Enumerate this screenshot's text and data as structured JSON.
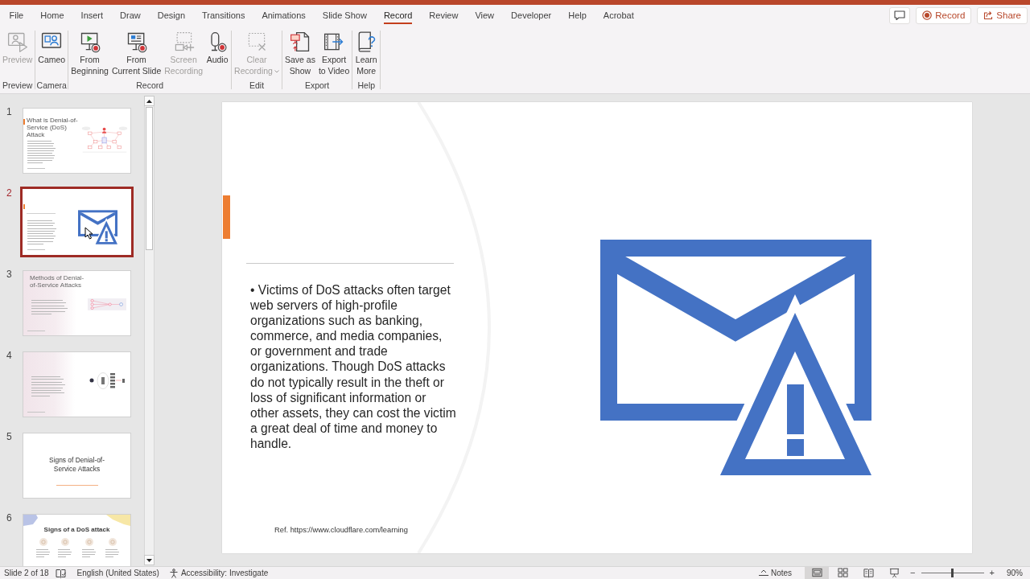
{
  "menu_tabs": [
    {
      "label": "File",
      "selected": false
    },
    {
      "label": "Home",
      "selected": false
    },
    {
      "label": "Insert",
      "selected": false
    },
    {
      "label": "Draw",
      "selected": false
    },
    {
      "label": "Design",
      "selected": false
    },
    {
      "label": "Transitions",
      "selected": false
    },
    {
      "label": "Animations",
      "selected": false
    },
    {
      "label": "Slide Show",
      "selected": false
    },
    {
      "label": "Record",
      "selected": true
    },
    {
      "label": "Review",
      "selected": false
    },
    {
      "label": "View",
      "selected": false
    },
    {
      "label": "Developer",
      "selected": false
    },
    {
      "label": "Help",
      "selected": false
    },
    {
      "label": "Acrobat",
      "selected": false
    }
  ],
  "quick_actions": [
    {
      "kind": "comments"
    },
    {
      "kind": "record",
      "label": "Record"
    },
    {
      "kind": "share",
      "label": "Share"
    }
  ],
  "ribbon": {
    "groups": [
      {
        "label": "Preview",
        "commands": [
          {
            "kind": "preview",
            "label_lines": [
              "Preview"
            ],
            "disabled": true,
            "dropdown": false
          }
        ]
      },
      {
        "label": "Camera",
        "commands": [
          {
            "kind": "cameo",
            "label_lines": [
              "Cameo"
            ],
            "disabled": false,
            "dropdown": false
          }
        ]
      },
      {
        "label": "Record",
        "commands": [
          {
            "kind": "from_beginning",
            "label_lines": [
              "From",
              "Beginning"
            ],
            "disabled": false,
            "dropdown": false
          },
          {
            "kind": "from_current",
            "label_lines": [
              "From",
              "Current Slide"
            ],
            "disabled": false,
            "dropdown": false
          },
          {
            "kind": "screen_recording",
            "label_lines": [
              "Screen",
              "Recording"
            ],
            "disabled": true,
            "dropdown": false
          },
          {
            "kind": "audio",
            "label_lines": [
              "Audio"
            ],
            "disabled": false,
            "dropdown": false
          }
        ]
      },
      {
        "label": "Edit",
        "commands": [
          {
            "kind": "clear_recording",
            "label_lines": [
              "Clear",
              "Recording"
            ],
            "disabled": true,
            "dropdown": true
          }
        ]
      },
      {
        "label": "Export",
        "commands": [
          {
            "kind": "save_show",
            "label_lines": [
              "Save as",
              "Show"
            ],
            "disabled": false,
            "dropdown": false
          },
          {
            "kind": "export_video",
            "label_lines": [
              "Export",
              "to Video"
            ],
            "disabled": false,
            "dropdown": false
          }
        ]
      },
      {
        "label": "Help",
        "commands": [
          {
            "kind": "learn_more",
            "label_lines": [
              "Learn",
              "More"
            ],
            "disabled": false,
            "dropdown": false
          }
        ]
      }
    ]
  },
  "slides_pane": {
    "slides": [
      {
        "number": "1",
        "selected": false,
        "kind": "text_network",
        "title": "What is Denial-of-Service (DoS) Attack",
        "pointer": false
      },
      {
        "number": "2",
        "selected": true,
        "kind": "text_icon",
        "pointer": true
      },
      {
        "number": "3",
        "selected": false,
        "kind": "text_flow",
        "title": "Methods of Denial-of-Service Attacks",
        "pointer": false
      },
      {
        "number": "4",
        "selected": false,
        "kind": "text_cluster",
        "pointer": false
      },
      {
        "number": "5",
        "selected": false,
        "kind": "section",
        "title": "Signs of Denial-of-Service Attacks",
        "pointer": false
      },
      {
        "number": "6",
        "selected": false,
        "kind": "cards",
        "title": "Signs of a DoS attack",
        "pointer": false
      }
    ]
  },
  "slide": {
    "body": "• Victims of DoS attacks often target web servers of high-profile organizations such as banking, commerce, and media companies, or government and trade organizations. Though DoS attacks do not typically result in the theft or loss of significant information or other assets, they can cost the victim a great deal of time and money to handle.",
    "reference": "Ref. https://www.cloudflare.com/learning"
  },
  "status_bar": {
    "slide_position": "Slide 2 of 18",
    "language": "English (United States)",
    "accessibility": "Accessibility: Investigate",
    "notes": "Notes",
    "views": [
      {
        "kind": "normal",
        "selected": true
      },
      {
        "kind": "sorter",
        "selected": false
      },
      {
        "kind": "reading",
        "selected": false
      },
      {
        "kind": "slideshow",
        "selected": false
      }
    ],
    "zoom_out": "−",
    "zoom": {
      "level": 0.5
    },
    "zoom_in": "+",
    "zoom_reading": "90%"
  }
}
